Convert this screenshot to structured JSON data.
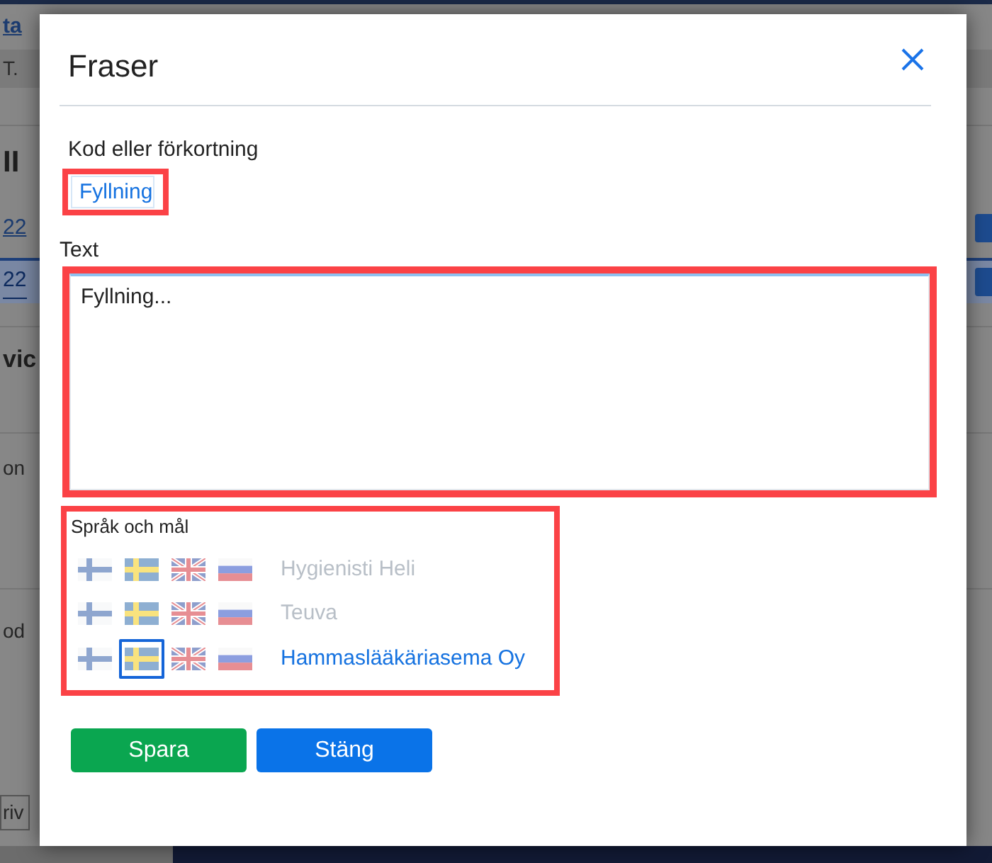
{
  "background_page": {
    "rows": [
      {
        "kind": "link",
        "text": "ta",
        "selected": false,
        "side_button": false
      },
      {
        "kind": "header",
        "text": "T.",
        "selected": false,
        "side_button": false
      },
      {
        "kind": "heading",
        "text": "II",
        "selected": false,
        "side_button": false
      },
      {
        "kind": "link",
        "text": "22",
        "selected": false,
        "side_button": true
      },
      {
        "kind": "link",
        "text": "22",
        "selected": true,
        "side_button": true
      },
      {
        "kind": "heading",
        "text": "vic",
        "selected": false,
        "side_button": false
      },
      {
        "kind": "text",
        "text": "on",
        "selected": false,
        "side_button": false
      },
      {
        "kind": "text",
        "text": "od",
        "selected": false,
        "side_button": false
      },
      {
        "kind": "field",
        "text": "riv",
        "selected": false,
        "side_button": false
      }
    ]
  },
  "dialog": {
    "title": "Fraser",
    "code_field": {
      "label": "Kod eller förkortning",
      "value": "Fyllning",
      "highlighted": true
    },
    "text_field": {
      "label": "Text",
      "value": "Fyllning...",
      "focused": true,
      "highlighted": true
    },
    "languages": {
      "label": "Språk och mål",
      "highlighted": true,
      "rows": [
        {
          "name": "Hygienisti Heli",
          "active": false,
          "flags": [
            {
              "kind": "fi",
              "selected": false
            },
            {
              "kind": "se",
              "selected": false
            },
            {
              "kind": "gb",
              "selected": false
            },
            {
              "kind": "ru",
              "selected": false
            }
          ]
        },
        {
          "name": "Teuva",
          "active": false,
          "flags": [
            {
              "kind": "fi",
              "selected": false
            },
            {
              "kind": "se",
              "selected": false
            },
            {
              "kind": "gb",
              "selected": false
            },
            {
              "kind": "ru",
              "selected": false
            }
          ]
        },
        {
          "name": "Hammaslääkäriasema Oy",
          "active": true,
          "flags": [
            {
              "kind": "fi",
              "selected": false
            },
            {
              "kind": "se",
              "selected": true
            },
            {
              "kind": "gb",
              "selected": false
            },
            {
              "kind": "ru",
              "selected": false
            }
          ]
        }
      ]
    },
    "buttons": [
      {
        "label": "Spara",
        "kind": "success"
      },
      {
        "label": "Stäng",
        "kind": "primary"
      }
    ]
  }
}
